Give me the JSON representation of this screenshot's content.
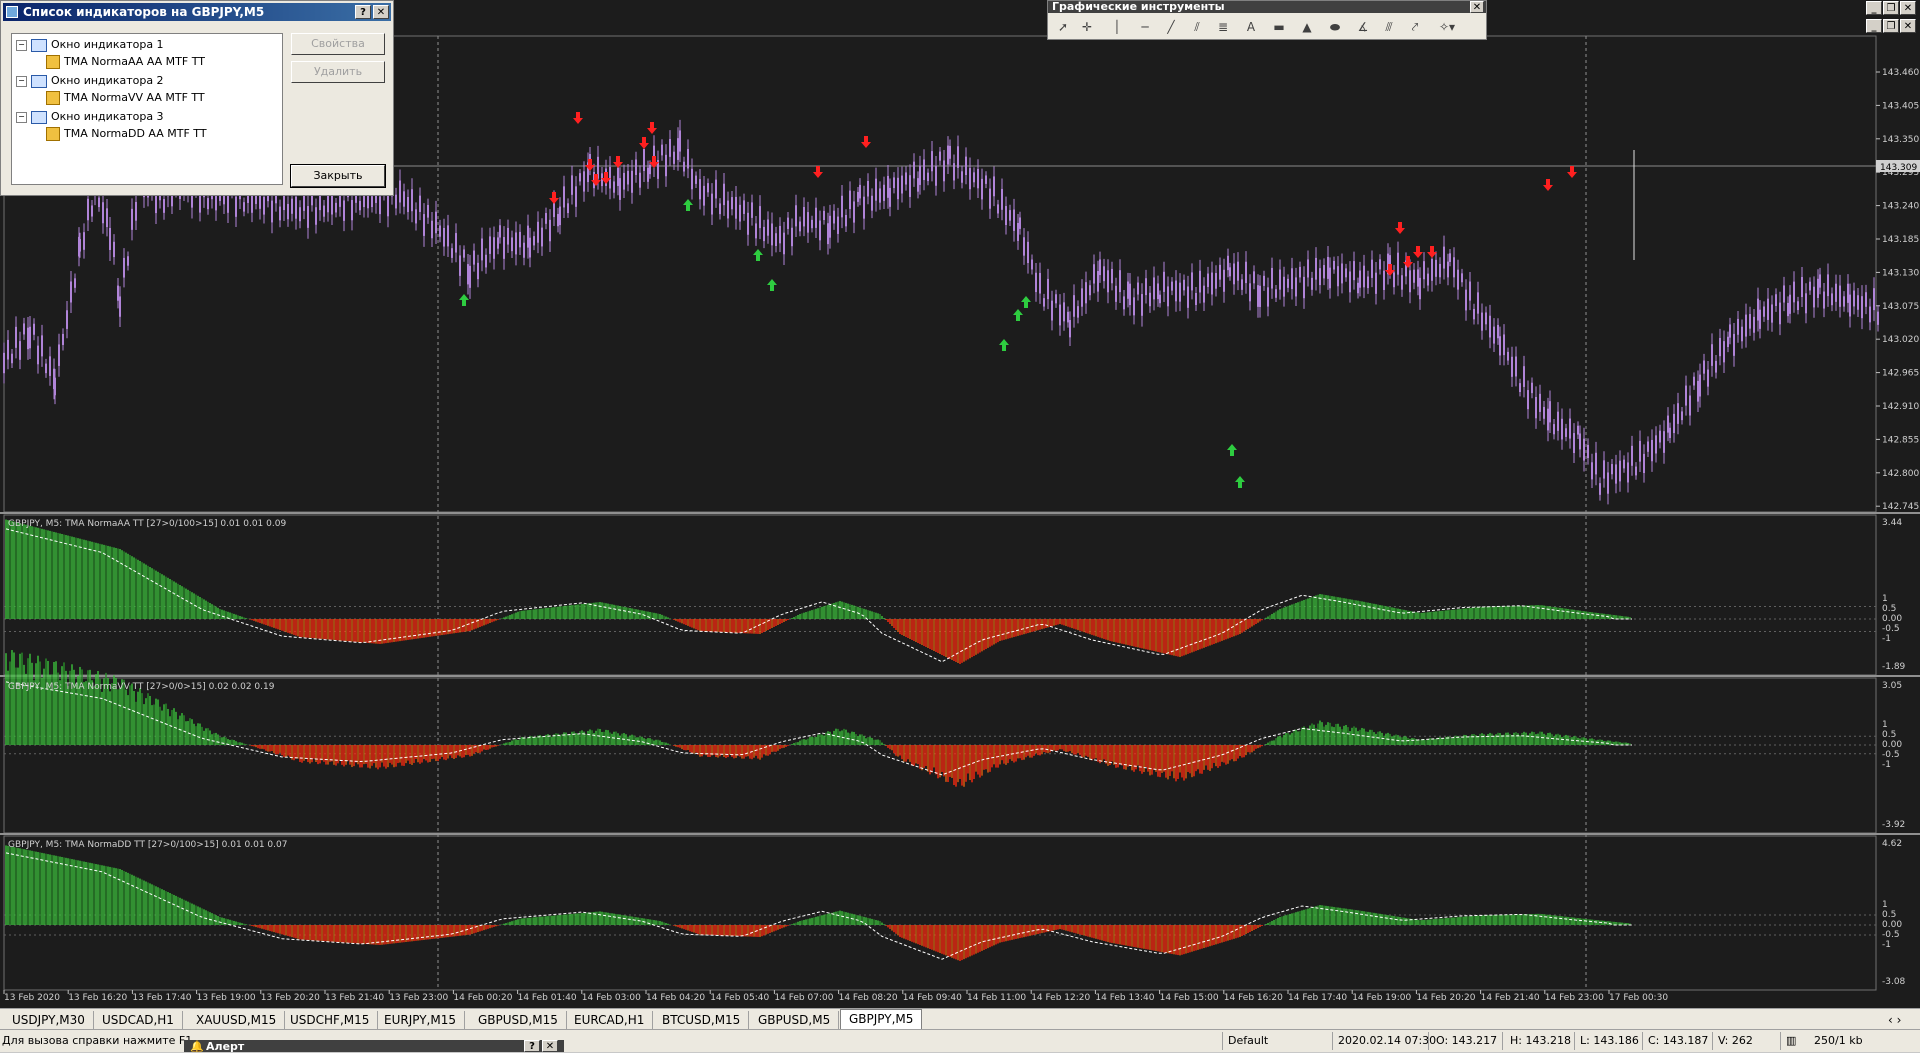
{
  "indicator_dialog": {
    "title": "Список индикаторов на GBPJPY,M5",
    "help_label": "?",
    "close_label": "✕",
    "tree": [
      {
        "label": "Окно индикатора 1",
        "child": "TMA NormaAA AA MTF TT"
      },
      {
        "label": "Окно индикатора 2",
        "child": "TMA NormaVV AA MTF TT"
      },
      {
        "label": "Окно индикатора 3",
        "child": "TMA NormaDD AA MTF TT"
      }
    ],
    "properties_button": "Свойства",
    "delete_button": "Удалить",
    "close_button": "Закрыть"
  },
  "graphic_tools": {
    "title": "Графические инструменты",
    "tools": [
      "cursor-icon",
      "crosshair-icon",
      "vertical-line-icon",
      "horizontal-line-icon",
      "trendline-icon",
      "fibonacci-icon",
      "channel-icon",
      "text-icon",
      "rectangle-icon",
      "triangle-icon",
      "ellipse-icon",
      "andrews-pitchfork-icon",
      "gann-fan-icon",
      "arrow-line-icon",
      "arrows-menu-icon"
    ]
  },
  "mdi_buttons": [
    "_",
    "❐",
    "✕"
  ],
  "main_chart": {
    "price_labels": [
      "143.460",
      "143.405",
      "143.350",
      "143.295",
      "143.240",
      "143.185",
      "143.130",
      "143.075",
      "143.020",
      "142.965",
      "142.910",
      "142.855",
      "142.800",
      "142.745"
    ],
    "current_price": "143.309",
    "colors": {
      "candle": "#b084d8",
      "up_arrow": "#2ecc40",
      "down_arrow": "#ff2020",
      "background": "#1c1c1c",
      "grid": "#5a5a5a"
    }
  },
  "indicators": [
    {
      "header": "GBPJPY, M5: TMA NormaAA TT [27>0/100>15]  0.01 0.01 0.09",
      "scale": [
        "3.44",
        "1",
        "0.5",
        "0.00",
        "-0.5",
        "-1",
        "-1.89"
      ]
    },
    {
      "header": "GBPJPY, M5: TMA NormaVV TT [27>0/0>15]  0.02 0.02 0.19",
      "scale": [
        "3.05",
        "1",
        "0.5",
        "0.00",
        "-0.5",
        "-1",
        "-3.92"
      ]
    },
    {
      "header": "GBPJPY, M5: TMA NormaDD TT [27>0/100>15]  0.01 0.01 0.07",
      "scale": [
        "4.62",
        "1",
        "0.5",
        "0.00",
        "-0.5",
        "-1",
        "-3.08"
      ]
    }
  ],
  "time_axis": [
    "13 Feb 2020",
    "13 Feb 16:20",
    "13 Feb 17:40",
    "13 Feb 19:00",
    "13 Feb 20:20",
    "13 Feb 21:40",
    "13 Feb 23:00",
    "14 Feb 00:20",
    "14 Feb 01:40",
    "14 Feb 03:00",
    "14 Feb 04:20",
    "14 Feb 05:40",
    "14 Feb 07:00",
    "14 Feb 08:20",
    "14 Feb 09:40",
    "14 Feb 11:00",
    "14 Feb 12:20",
    "14 Feb 13:40",
    "14 Feb 15:00",
    "14 Feb 16:20",
    "14 Feb 17:40",
    "14 Feb 19:00",
    "14 Feb 20:20",
    "14 Feb 21:40",
    "14 Feb 23:00",
    "17 Feb 00:30"
  ],
  "tabs": [
    "USDJPY,M30",
    "USDCAD,H1",
    "XAUUSD,M15",
    "USDCHF,M15",
    "EURJPY,M15",
    "GBPUSD,M15",
    "EURCAD,H1",
    "BTCUSD,M15",
    "GBPUSD,M5",
    "GBPJPY,M5"
  ],
  "active_tab": "GBPJPY,M5",
  "status": {
    "help": "Для вызова справки нажмите F1",
    "profile": "Default",
    "datetime": "2020.02.14 07:30",
    "open": "O: 143.217",
    "high": "H: 143.218",
    "low": "L: 143.186",
    "close": "C: 143.187",
    "volume": "V: 262",
    "traffic": "250/1 kb"
  },
  "alert_window": {
    "title": "Алерт",
    "help_label": "?",
    "close_label": "✕"
  }
}
